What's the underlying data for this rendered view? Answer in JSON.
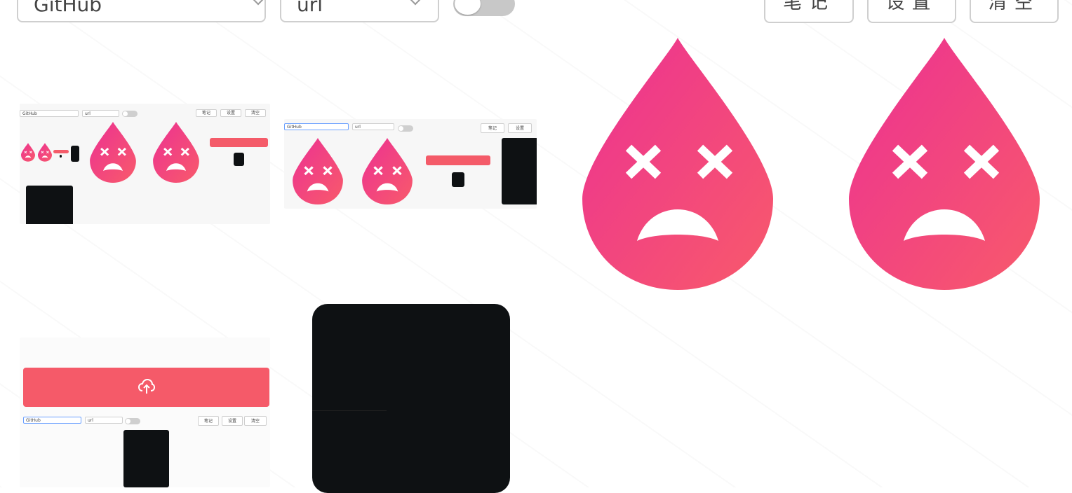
{
  "toolbar": {
    "host_select_value": "GitHub",
    "type_select_value": "url",
    "toggle_on": false,
    "notes_label": "笔记",
    "settings_label": "设置",
    "clear_label": "清空"
  },
  "thumbnails": {
    "mini_host_value": "GitHub",
    "mini_type_value": "url",
    "mini_notes_label": "笔记",
    "mini_settings_label": "设置",
    "mini_clear_label": "清空"
  },
  "colors": {
    "accent": "#f55a69",
    "drop_top": "#ee3b96",
    "drop_bottom": "#f7586c",
    "dark_block": "#0e1113",
    "border": "#cfcfcf"
  },
  "icons": [
    "chevron-down-icon",
    "sad-drop-icon",
    "upload-cloud-icon"
  ]
}
